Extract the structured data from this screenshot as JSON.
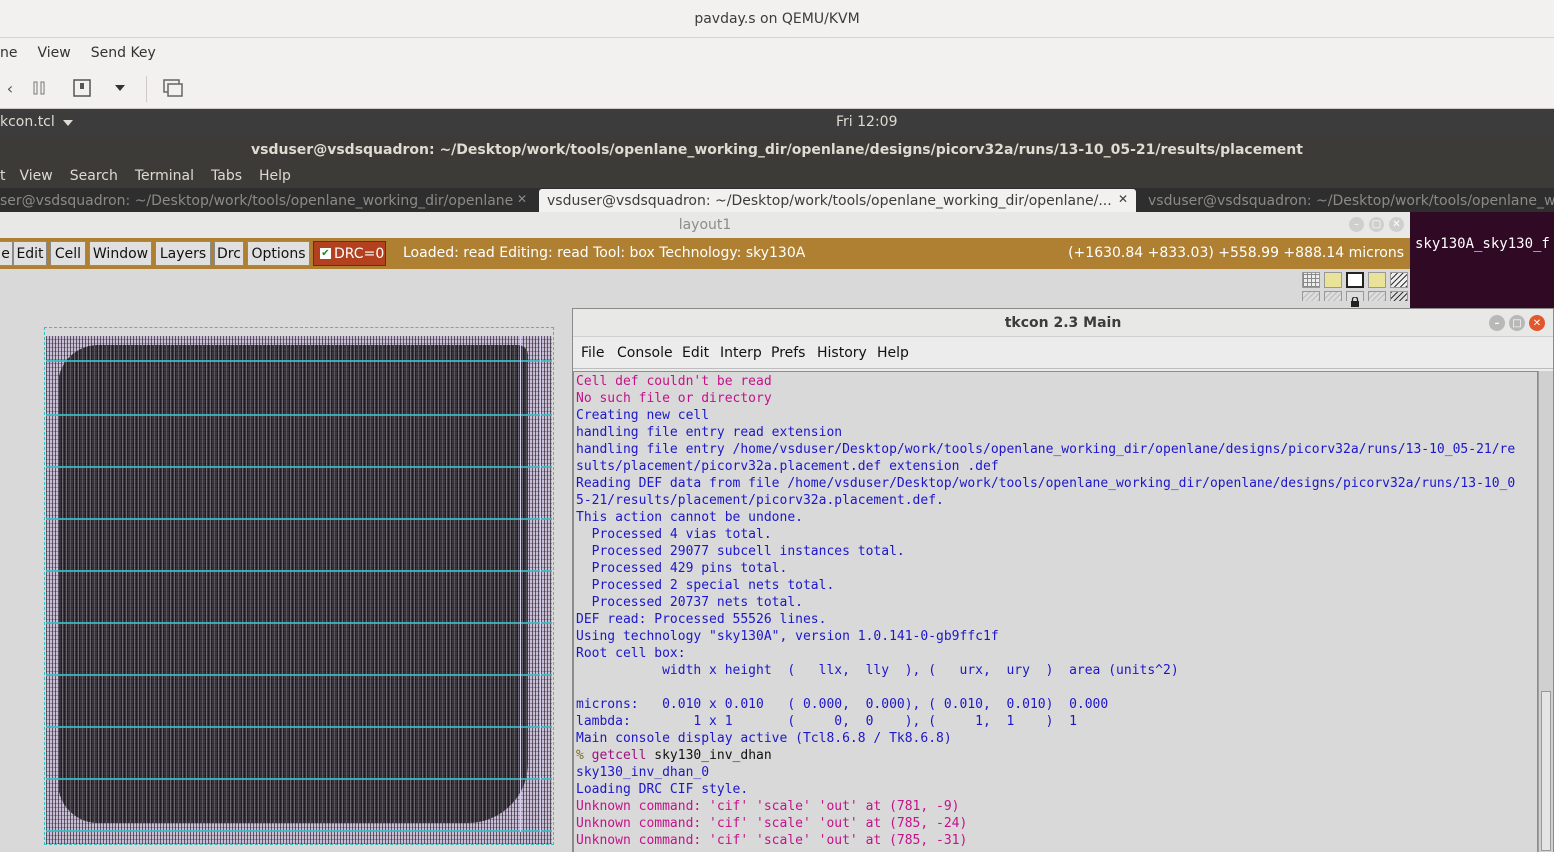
{
  "qemu": {
    "window_title": "pavday.s on QEMU/KVM",
    "menus": [
      "ne",
      "View",
      "Send Key"
    ]
  },
  "guest": {
    "app_menu": "kcon.tcl",
    "clock": "Fri 12:09"
  },
  "terminal": {
    "title": "vsduser@vsdsquadron: ~/Desktop/work/tools/openlane_working_dir/openlane/designs/picorv32a/runs/13-10_05-21/results/placement",
    "menus": [
      "t",
      "View",
      "Search",
      "Terminal",
      "Tabs",
      "Help"
    ],
    "tabs": [
      {
        "label": "ser@vsdsquadron: ~/Desktop/work/tools/openlane_working_dir/openlane"
      },
      {
        "label": "vsduser@vsdsquadron: ~/Desktop/work/tools/openlane_working_dir/openlane/..."
      },
      {
        "label": "vsduser@vsdsquadron: ~/Desktop/work/tools/openlane_working_dir/openlane_wo"
      }
    ],
    "peek_text": "sky130A_sky130_f"
  },
  "layout": {
    "window_title": "layout1",
    "menus": [
      "e",
      "Edit",
      "Cell",
      "Window",
      "Layers",
      "Drc",
      "Options"
    ],
    "drc_label": "DRC=0",
    "status": "Loaded: read Editing: read Tool: box  Technology: sky130A",
    "coords": "(+1630.84 +833.03) +558.99 +888.14 microns"
  },
  "tkcon": {
    "title": "tkcon 2.3 Main",
    "menus": [
      {
        "label": "File",
        "u": "F"
      },
      {
        "label": "Console",
        "u": "C"
      },
      {
        "label": "Edit",
        "u": "E"
      },
      {
        "label": "Interp",
        "u": "I"
      },
      {
        "label": "Prefs",
        "u": "P"
      },
      {
        "label": "History",
        "u": "H"
      },
      {
        "label": "Help",
        "u": "H"
      }
    ],
    "console_lines": [
      {
        "cls": "c-err",
        "text": "Cell def couldn't be read"
      },
      {
        "cls": "c-err",
        "text": "No such file or directory"
      },
      {
        "cls": "c-info",
        "text": "Creating new cell"
      },
      {
        "cls": "c-info",
        "text": "handling file entry read extension"
      },
      {
        "cls": "c-info",
        "text": "handling file entry /home/vsduser/Desktop/work/tools/openlane_working_dir/openlane/designs/picorv32a/runs/13-10_05-21/re"
      },
      {
        "cls": "c-info",
        "text": "sults/placement/picorv32a.placement.def extension .def"
      },
      {
        "cls": "c-info",
        "text": "Reading DEF data from file /home/vsduser/Desktop/work/tools/openlane_working_dir/openlane/designs/picorv32a/runs/13-10_0"
      },
      {
        "cls": "c-info",
        "text": "5-21/results/placement/picorv32a.placement.def."
      },
      {
        "cls": "c-info",
        "text": "This action cannot be undone."
      },
      {
        "cls": "c-info",
        "text": "  Processed 4 vias total."
      },
      {
        "cls": "c-info",
        "text": "  Processed 29077 subcell instances total."
      },
      {
        "cls": "c-info",
        "text": "  Processed 429 pins total."
      },
      {
        "cls": "c-info",
        "text": "  Processed 2 special nets total."
      },
      {
        "cls": "c-info",
        "text": "  Processed 20737 nets total."
      },
      {
        "cls": "c-info",
        "text": "DEF read: Processed 55526 lines."
      },
      {
        "cls": "c-info",
        "text": "Using technology \"sky130A\", version 1.0.141-0-gb9ffc1f"
      },
      {
        "cls": "c-info",
        "text": "Root cell box:"
      },
      {
        "cls": "c-info",
        "text": "           width x height  (   llx,  lly  ), (   urx,  ury  )  area (units^2)"
      },
      {
        "cls": "c-info",
        "text": ""
      },
      {
        "cls": "c-info",
        "text": "microns:   0.010 x 0.010   ( 0.000,  0.000), ( 0.010,  0.010)  0.000"
      },
      {
        "cls": "c-info",
        "text": "lambda:        1 x 1       (     0,  0    ), (     1,  1    )  1"
      },
      {
        "cls": "c-info",
        "text": "Main console display active (Tcl8.6.8 / Tk8.6.8)"
      },
      {
        "cls": "c-cmd",
        "prompt": "% ",
        "kw": "getcell",
        "text": " sky130_inv_dhan"
      },
      {
        "cls": "c-info",
        "text": "sky130_inv_dhan_0"
      },
      {
        "cls": "c-info",
        "text": "Loading DRC CIF style."
      },
      {
        "cls": "c-err",
        "text": "Unknown command: 'cif' 'scale' 'out' at (781, -9)"
      },
      {
        "cls": "c-err",
        "text": "Unknown command: 'cif' 'scale' 'out' at (785, -24)"
      },
      {
        "cls": "c-err",
        "text": "Unknown command: 'cif' 'scale' 'out' at (785, -31)"
      }
    ]
  },
  "colors": {
    "magic_menubar": "#b08032",
    "drc_button": "#b3401f",
    "console_bg": "#d9d9d9",
    "error_text": "#c4128a",
    "info_text": "#1d17c9",
    "terminal_bg": "#300a24"
  }
}
